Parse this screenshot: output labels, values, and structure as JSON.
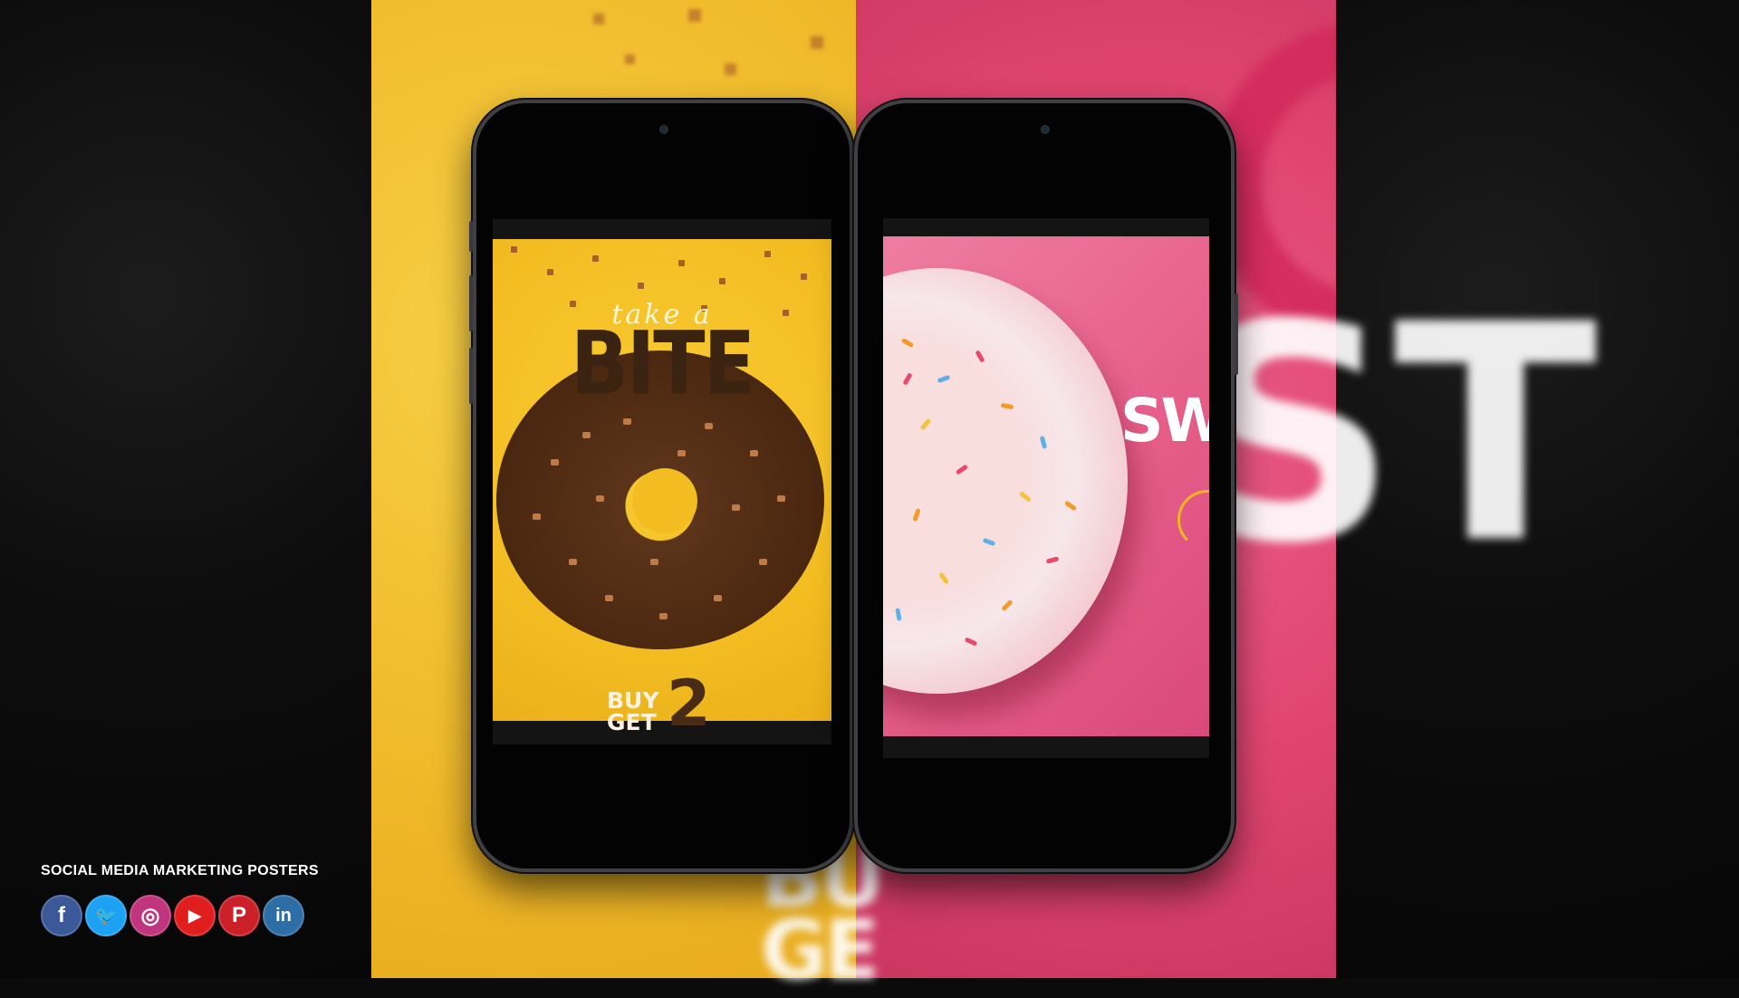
{
  "poster_left": {
    "script_text": "take a",
    "headline": "BITE",
    "promo_line1": "BUY",
    "promo_line2": "GET",
    "promo_number": "2"
  },
  "poster_right": {
    "headline_fragment": "SW"
  },
  "footer": {
    "title": "SOCIAL MEDIA MARKETING POSTERS",
    "icons": [
      {
        "name": "facebook-icon",
        "glyph": "f",
        "color": "#3b5998"
      },
      {
        "name": "twitter-icon",
        "glyph": "🐦",
        "color": "#1da1f2"
      },
      {
        "name": "instagram-icon",
        "glyph": "◎",
        "color": "#c1357e"
      },
      {
        "name": "youtube-icon",
        "glyph": "▶",
        "color": "#e01e1e"
      },
      {
        "name": "pinterest-icon",
        "glyph": "P",
        "color": "#cb2027"
      },
      {
        "name": "linkedin-icon",
        "glyph": "in",
        "color": "#2e6ea6"
      }
    ]
  },
  "colors": {
    "yellow_bg": "#f1bd2e",
    "pink_bg": "#e0456f",
    "chocolate": "#4a2710"
  }
}
